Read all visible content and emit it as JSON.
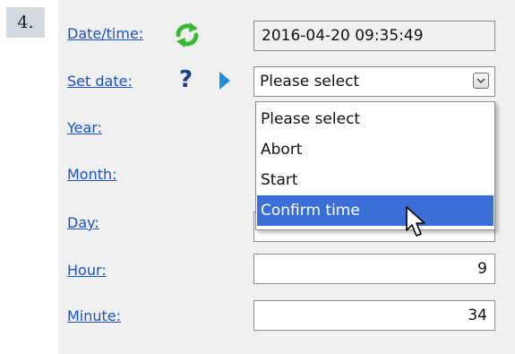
{
  "step": "4.",
  "form": {
    "datetime": {
      "label": "Date/time:",
      "value": "2016-04-20 09:35:49"
    },
    "set_date": {
      "label": "Set date:",
      "selected": "Please select",
      "help_icon": "question-mark-icon",
      "pointer_icon": "triangle-pointer-icon"
    },
    "year": {
      "label": "Year:"
    },
    "month": {
      "label": "Month:"
    },
    "day": {
      "label": "Day:"
    },
    "hour": {
      "label": "Hour:",
      "value": "9"
    },
    "minute": {
      "label": "Minute:",
      "value": "34"
    }
  },
  "dropdown": {
    "options": [
      "Please select",
      "Abort",
      "Start",
      "Confirm time"
    ],
    "highlighted": "Confirm time"
  },
  "icons": [
    "refresh-icon",
    "question-mark-icon",
    "triangle-pointer-icon",
    "chevron-down-icon",
    "mouse-pointer-icon"
  ],
  "colors": {
    "link": "#1a52c8",
    "refresh": "#3bb838",
    "help": "#1a3f8f",
    "pointer": "#1f8fdc",
    "highlight": "#3b6fd8",
    "panel": "#f0f0f0"
  }
}
